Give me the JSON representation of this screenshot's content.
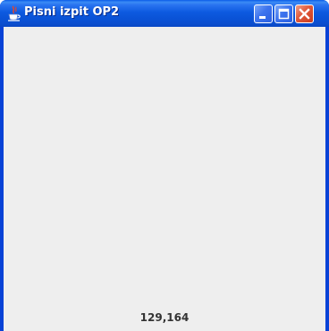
{
  "window": {
    "title": "Pisni izpit OP2",
    "controls": {
      "minimize": "minimize",
      "maximize": "maximize",
      "close": "close"
    }
  },
  "content": {
    "mouse_coordinates": "129,164"
  },
  "colors": {
    "titlebar": "#0a52d6",
    "client_background": "#eeeeee",
    "close_button": "#e0583a"
  },
  "icons": {
    "app": "java-cup-icon",
    "minimize": "minimize-icon",
    "maximize": "maximize-icon",
    "close": "close-icon"
  }
}
